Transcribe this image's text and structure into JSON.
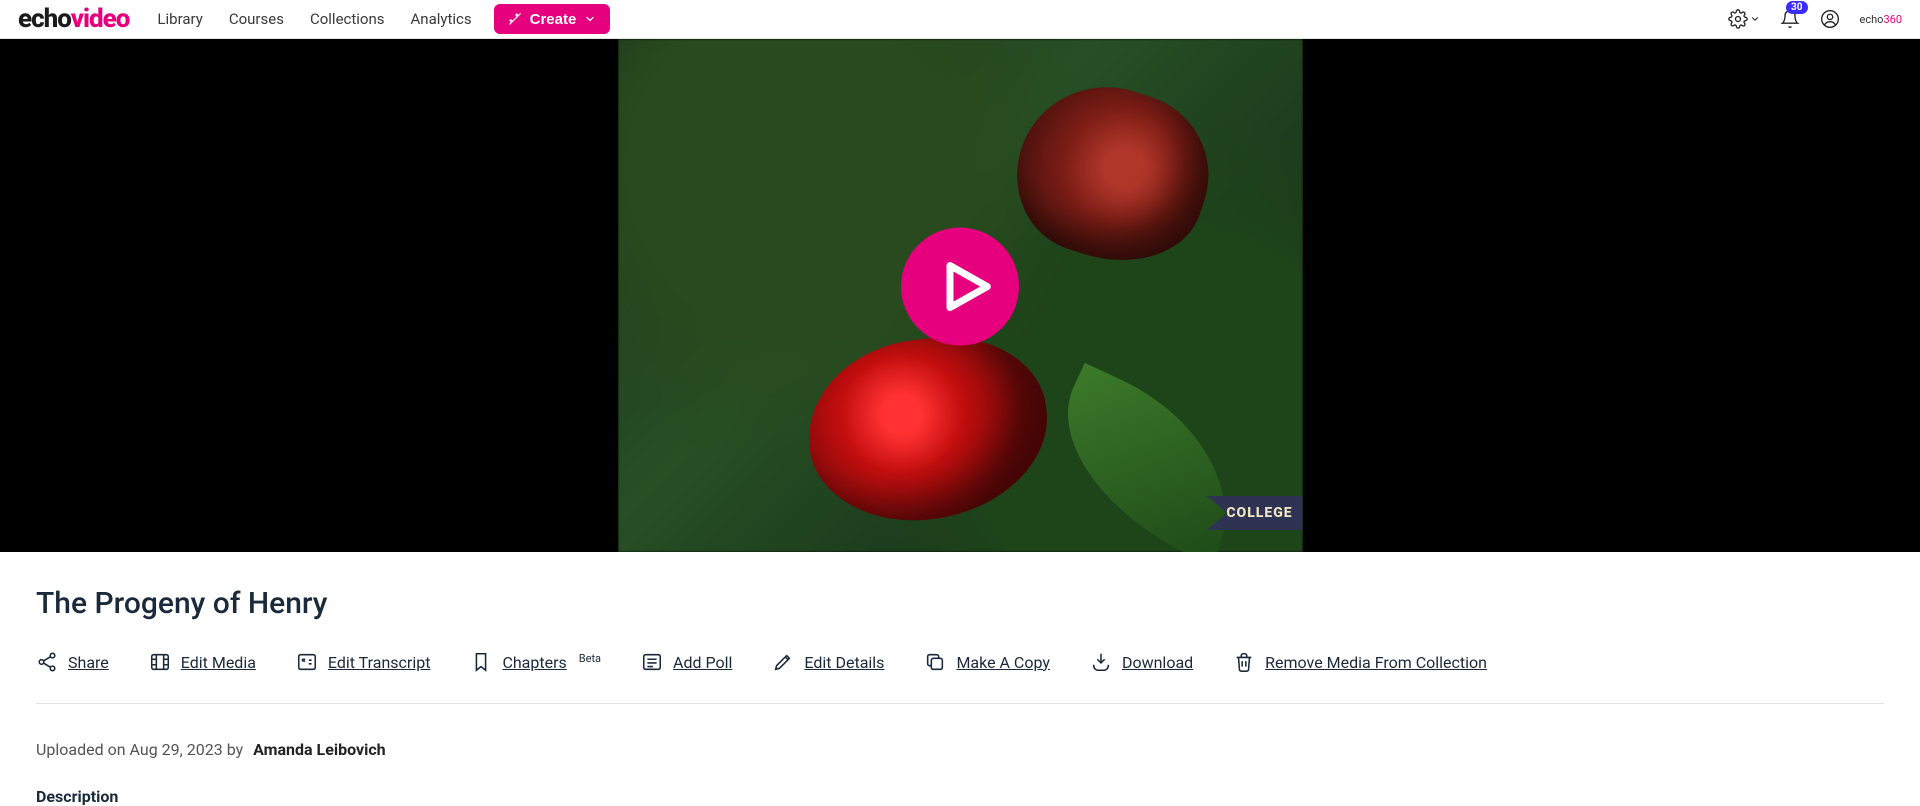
{
  "logo": {
    "part1": "echo",
    "part2": "video"
  },
  "nav": {
    "library": "Library",
    "courses": "Courses",
    "collections": "Collections",
    "analytics": "Analytics"
  },
  "create_label": "Create",
  "notification_count": "30",
  "brandmark": {
    "part1": "echo",
    "part2": "360"
  },
  "video": {
    "title": "The Progeny of Henry",
    "pennant_text": "COLLEGE"
  },
  "actions": {
    "share": "Share",
    "edit_media": "Edit Media",
    "edit_transcript": "Edit Transcript",
    "chapters": "Chapters",
    "chapters_badge": "Beta",
    "add_poll": "Add Poll",
    "edit_details": "Edit Details",
    "make_copy": "Make A Copy",
    "download": "Download",
    "remove": "Remove Media From Collection"
  },
  "meta": {
    "uploaded_prefix": "Uploaded on ",
    "uploaded_date": "Aug 29, 2023",
    "by_word": " by ",
    "author": "Amanda Leibovich"
  },
  "description_heading": "Description"
}
